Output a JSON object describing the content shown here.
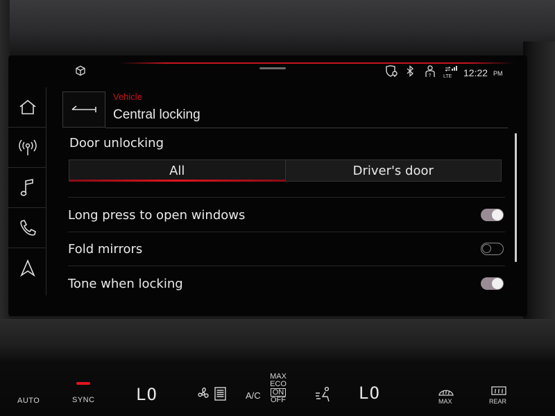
{
  "status_bar": {
    "time": "12:22",
    "ampm": "PM",
    "lte": "LTE"
  },
  "nav_rail": [
    "home",
    "radio",
    "media",
    "phone",
    "navigation"
  ],
  "header": {
    "breadcrumb": "Vehicle",
    "title": "Central locking"
  },
  "door_unlocking": {
    "title": "Door unlocking",
    "options": [
      "All",
      "Driver's door"
    ],
    "selected": "All"
  },
  "settings": [
    {
      "label": "Long press to open windows",
      "state": "on"
    },
    {
      "label": "Fold mirrors",
      "state": "off"
    },
    {
      "label": "Tone when locking",
      "state": "on"
    }
  ],
  "climate": {
    "auto": "AUTO",
    "sync": "SYNC",
    "left_temp": "LO",
    "ac": "A/C",
    "ac_modes": [
      "MAX",
      "ECO",
      "ON",
      "OFF"
    ],
    "right_temp": "LO",
    "max_defrost": "MAX",
    "rear_defrost": "REAR"
  },
  "colors": {
    "accent_red": "#c8141e",
    "toggle_on": "#9a8c94"
  }
}
